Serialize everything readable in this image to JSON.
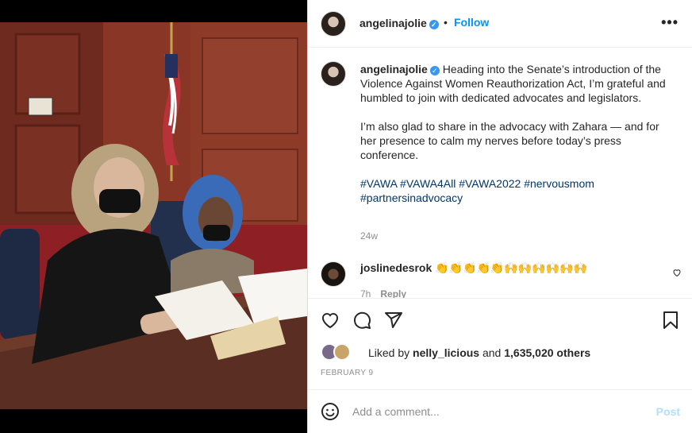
{
  "post": {
    "username": "angelinajolie",
    "separator": "•",
    "follow_label": "Follow",
    "more_label": "•••",
    "verified_mark": "✓"
  },
  "caption": {
    "username": "angelinajolie",
    "paragraph1": "Heading into the Senate’s introduction of the Violence Against Women Reauthorization Act, I’m grateful and humbled to join with dedicated advocates and legislators.",
    "paragraph2": "I’m also glad to share in the advocacy with Zahara — and for her presence to calm my nerves before today’s press conference.",
    "hashtags": "#VAWA #VAWA4All #VAWA2022 #nervousmom #partnersinadvocacy",
    "time": "24w"
  },
  "comment": {
    "username": "joslinedesrok",
    "text": "👏👏👏👏👏🙌🙌🙌🙌🙌🙌",
    "time": "7h",
    "reply_label": "Reply"
  },
  "likes": {
    "prefix": "Liked by",
    "user": "nelly_licious",
    "and_label": "and",
    "count": "1,635,020 others"
  },
  "date": "FEBRUARY 9",
  "add_comment": {
    "placeholder": "Add a comment...",
    "post_label": "Post"
  },
  "icons": [
    "heart-icon",
    "comment-icon",
    "share-icon",
    "bookmark-icon",
    "emoji-icon",
    "more-icon"
  ],
  "colors": {
    "link": "#0095f6",
    "hashtag": "#00376b",
    "muted": "#8e8e8e",
    "post_disabled": "#b2dffc"
  }
}
